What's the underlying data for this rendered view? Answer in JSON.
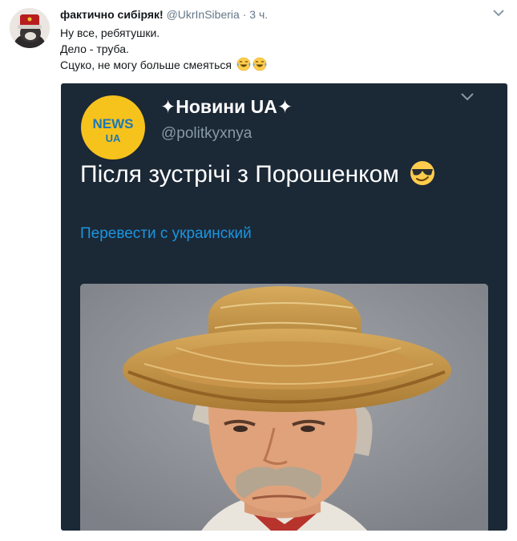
{
  "tweet": {
    "author_name": "фактично сибіряк!",
    "handle": "@UkrInSiberia",
    "separator": "·",
    "time": "3 ч.",
    "lines": [
      "Ну все, ребятушки.",
      "Дело - труба.",
      "Сцуко, не могу больше смеяться"
    ],
    "emojis": [
      "face-with-tears-of-joy",
      "face-with-tears-of-joy"
    ],
    "avatar_icon": "cat-in-hat-avatar",
    "menu_icon": "chevron-down-icon"
  },
  "embedded_tweet": {
    "logo_top": "NEWS",
    "logo_bottom": "UA",
    "display_name": "✦Новини UA✦",
    "handle": "@politkyxnya",
    "text": "Після зустрічі з Порошенком",
    "text_emoji": "smiling-face-with-sunglasses",
    "translate_link": "Перевести с украинский",
    "photo": "man-in-straw-hat",
    "colors": {
      "background": "#1b2836",
      "link": "#1b95e0",
      "logo": "#f6c21c"
    }
  }
}
